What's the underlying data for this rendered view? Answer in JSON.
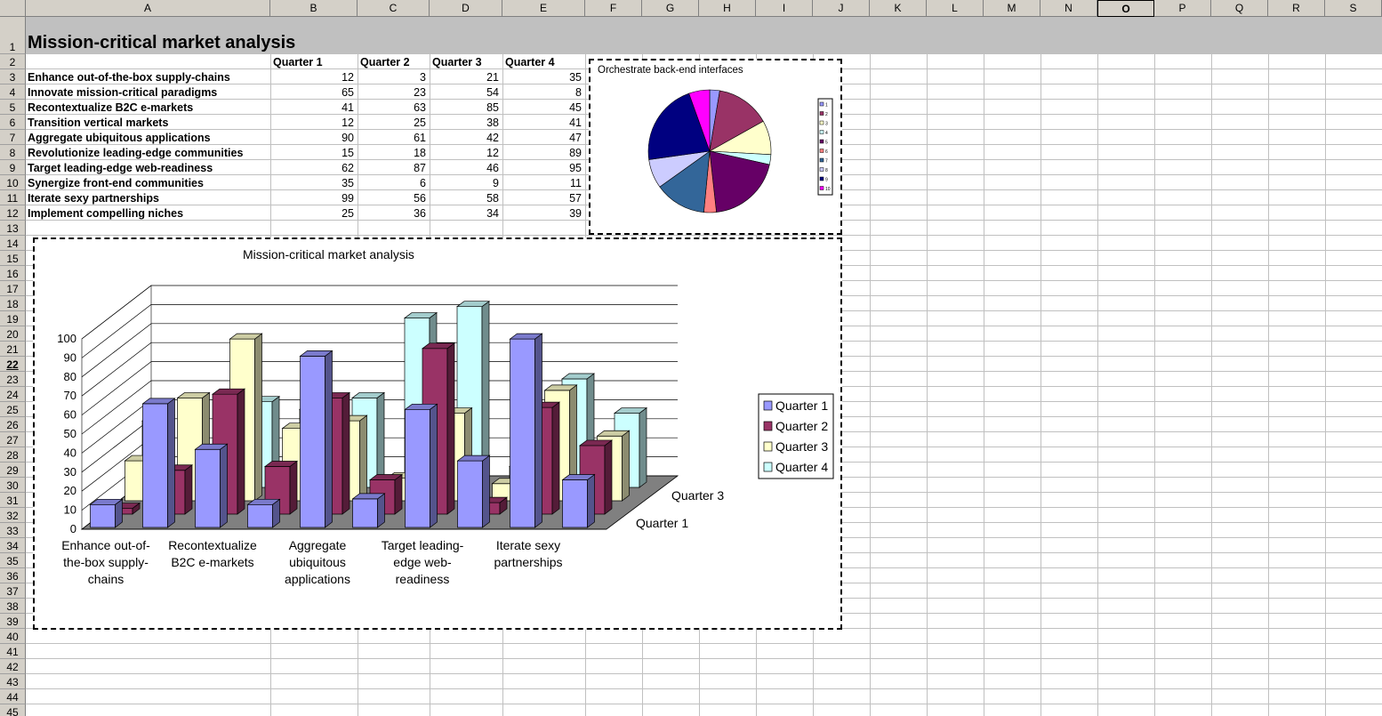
{
  "spreadsheet": {
    "columns": [
      "A",
      "B",
      "C",
      "D",
      "E",
      "F",
      "G",
      "H",
      "I",
      "J",
      "K",
      "L",
      "M",
      "N",
      "O",
      "P",
      "Q",
      "R",
      "S"
    ],
    "selected_column": "O",
    "selected_row": 22,
    "rows": [
      "1",
      "2",
      "3",
      "4",
      "5",
      "6",
      "7",
      "8",
      "9",
      "10",
      "11",
      "12",
      "13",
      "14",
      "15",
      "16",
      "17",
      "18",
      "19",
      "20",
      "21",
      "22",
      "23",
      "24",
      "25",
      "26",
      "27",
      "28",
      "29",
      "30",
      "31",
      "32",
      "33",
      "34",
      "35",
      "36",
      "37",
      "38",
      "39",
      "40",
      "41",
      "42",
      "43",
      "44",
      "45"
    ],
    "title": "Mission-critical market analysis",
    "headers": [
      "Quarter 1",
      "Quarter 2",
      "Quarter 3",
      "Quarter 4"
    ],
    "data_rows": [
      {
        "label": "Enhance out-of-the-box supply-chains",
        "values": [
          "12",
          "3",
          "21",
          "35"
        ]
      },
      {
        "label": "Innovate mission-critical paradigms",
        "values": [
          "65",
          "23",
          "54",
          "8"
        ]
      },
      {
        "label": "Recontextualize B2C e-markets",
        "values": [
          "41",
          "63",
          "85",
          "45"
        ]
      },
      {
        "label": "Transition vertical markets",
        "values": [
          "12",
          "25",
          "38",
          "41"
        ]
      },
      {
        "label": "Aggregate ubiquitous applications",
        "values": [
          "90",
          "61",
          "42",
          "47"
        ]
      },
      {
        "label": "Revolutionize leading-edge communities",
        "values": [
          "15",
          "18",
          "12",
          "89"
        ]
      },
      {
        "label": "Target leading-edge web-readiness",
        "values": [
          "62",
          "87",
          "46",
          "95"
        ]
      },
      {
        "label": "Synergize front-end communities",
        "values": [
          "35",
          "6",
          "9",
          "11"
        ]
      },
      {
        "label": "Iterate sexy partnerships",
        "values": [
          "99",
          "56",
          "58",
          "57"
        ]
      },
      {
        "label": "Implement compelling niches",
        "values": [
          "25",
          "36",
          "34",
          "39"
        ]
      }
    ]
  },
  "colors": {
    "q1": "#9999ff",
    "q2": "#993366",
    "q3": "#ffffcc",
    "q4": "#ccffff",
    "header_bg": "#d4d0c8",
    "title_bg": "#c0c0c0"
  },
  "pie_chart": {
    "title": "Orchestrate back-end interfaces",
    "legend": [
      "1",
      "2",
      "3",
      "4",
      "5",
      "6",
      "7",
      "8",
      "9",
      "10"
    ],
    "chart_data": {
      "type": "pie",
      "title": "Orchestrate back-end interfaces",
      "labels": [
        "1",
        "2",
        "3",
        "4",
        "5",
        "6",
        "7",
        "8",
        "9",
        "10"
      ],
      "values": [
        12,
        65,
        41,
        12,
        90,
        15,
        62,
        35,
        99,
        25
      ],
      "colors": [
        "#9999ff",
        "#993366",
        "#ffffcc",
        "#ccffff",
        "#660066",
        "#ff8080",
        "#336699",
        "#ccccff",
        "#000080",
        "#ff00ff"
      ]
    }
  },
  "bar_chart": {
    "title": "Mission-critical market analysis",
    "x_labels": [
      [
        "Enhance out-of-",
        "the-box supply-",
        "chains"
      ],
      [
        "Recontextualize",
        "B2C e-markets"
      ],
      [
        "Aggregate",
        "ubiquitous",
        "applications"
      ],
      [
        "Target leading-",
        "edge web-",
        "readiness"
      ],
      [
        "Iterate sexy",
        "partnerships"
      ]
    ],
    "depth_labels": [
      "Quarter 3",
      "Quarter 1"
    ],
    "y_ticks": [
      "0",
      "10",
      "20",
      "30",
      "40",
      "50",
      "60",
      "70",
      "80",
      "90",
      "100"
    ],
    "chart_data": {
      "type": "bar",
      "title": "Mission-critical market analysis",
      "categories": [
        "Enhance out-of-the-box supply-chains",
        "Innovate mission-critical paradigms",
        "Recontextualize B2C e-markets",
        "Transition vertical markets",
        "Aggregate ubiquitous applications",
        "Revolutionize leading-edge communities",
        "Target leading-edge web-readiness",
        "Synergize front-end communities",
        "Iterate sexy partnerships",
        "Implement compelling niches"
      ],
      "series": [
        {
          "name": "Quarter 1",
          "values": [
            12,
            65,
            41,
            12,
            90,
            15,
            62,
            35,
            99,
            25
          ]
        },
        {
          "name": "Quarter 2",
          "values": [
            3,
            23,
            63,
            25,
            61,
            18,
            87,
            6,
            56,
            36
          ]
        },
        {
          "name": "Quarter 3",
          "values": [
            21,
            54,
            85,
            38,
            42,
            12,
            46,
            9,
            58,
            34
          ]
        },
        {
          "name": "Quarter 4",
          "values": [
            35,
            8,
            45,
            41,
            47,
            89,
            95,
            11,
            57,
            39
          ]
        }
      ],
      "ylim": [
        0,
        100
      ],
      "grid": true,
      "legend": "right"
    }
  }
}
